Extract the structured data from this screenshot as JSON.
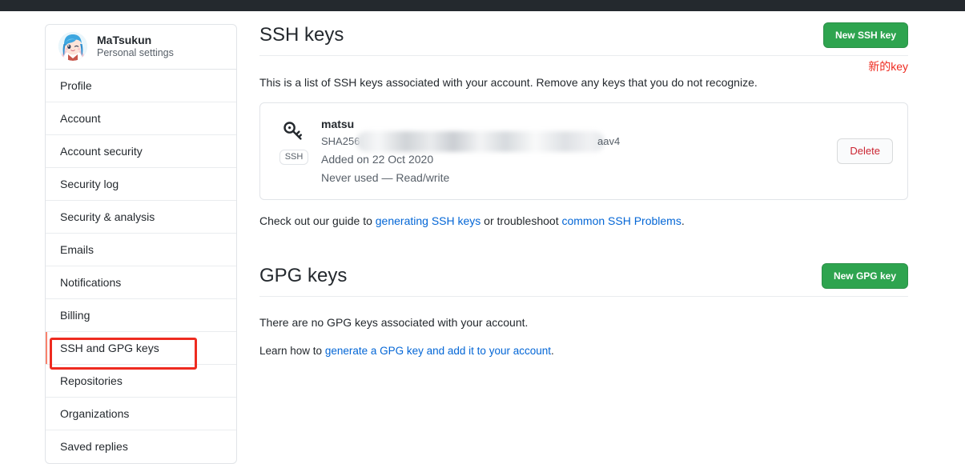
{
  "sidebar": {
    "profile": {
      "name": "MaTsukun",
      "subtitle": "Personal settings",
      "avatar_icon": "anime-avatar"
    },
    "items": [
      {
        "label": "Profile",
        "active": false
      },
      {
        "label": "Account",
        "active": false
      },
      {
        "label": "Account security",
        "active": false
      },
      {
        "label": "Security log",
        "active": false
      },
      {
        "label": "Security & analysis",
        "active": false
      },
      {
        "label": "Emails",
        "active": false
      },
      {
        "label": "Notifications",
        "active": false
      },
      {
        "label": "Billing",
        "active": false
      },
      {
        "label": "SSH and GPG keys",
        "active": true
      },
      {
        "label": "Repositories",
        "active": false
      },
      {
        "label": "Organizations",
        "active": false
      },
      {
        "label": "Saved replies",
        "active": false
      }
    ]
  },
  "ssh_section": {
    "title": "SSH keys",
    "new_key_button": "New SSH key",
    "annotation": "新的key",
    "annotation_color": "#ee2b20",
    "description": "This is a list of SSH keys associated with your account. Remove any keys that you do not recognize.",
    "key": {
      "name": "matsu",
      "key_icon": "key-icon",
      "type_badge": "SSH",
      "fingerprint_prefix": "SHA256",
      "fingerprint_suffix": "aav4",
      "added_on": "Added on 22 Oct 2020",
      "usage": "Never used — Read/write",
      "delete_button": "Delete"
    },
    "guide": {
      "before": "Check out our guide to ",
      "link1": "generating SSH keys",
      "middle": " or troubleshoot ",
      "link2": "common SSH Problems",
      "after": "."
    }
  },
  "gpg_section": {
    "title": "GPG keys",
    "new_key_button": "New GPG key",
    "empty_message": "There are no GPG keys associated with your account.",
    "learn": {
      "before": "Learn how to ",
      "link": "generate a GPG key and add it to your account",
      "after": "."
    }
  },
  "theme": {
    "topbar_color": "#24292e",
    "green": "#2ea44f",
    "link_blue": "#0366d6",
    "danger_red": "#cb2431",
    "active_marker": "#f9826c"
  }
}
